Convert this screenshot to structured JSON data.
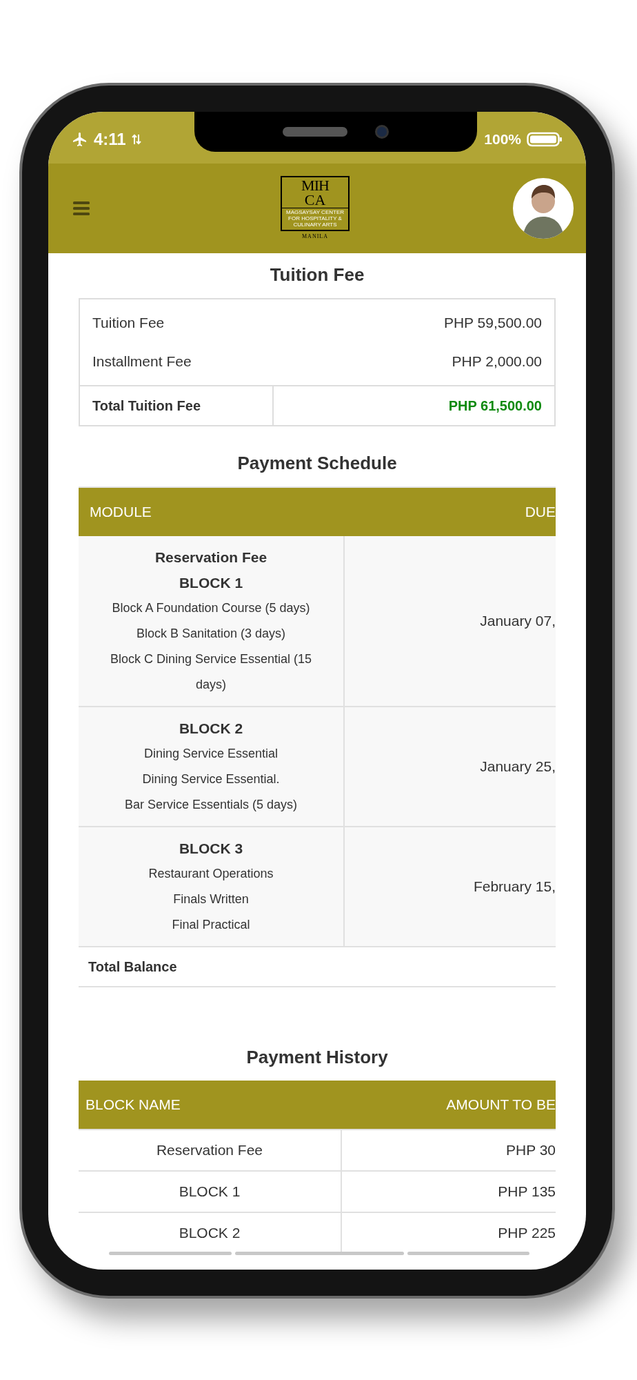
{
  "status_bar": {
    "time": "4:11",
    "battery": "100%",
    "airplane_mode": true
  },
  "header": {
    "logo": {
      "mark_top": "MIH",
      "mark_bottom": "CA",
      "tagline": "MAGSAYSAY CENTER FOR HOSPITALITY & CULINARY ARTS",
      "place": "MANILA"
    }
  },
  "tuition": {
    "title": "Tuition Fee",
    "rows": [
      {
        "label": "Tuition Fee",
        "amount": "PHP 59,500.00"
      },
      {
        "label": "Installment Fee",
        "amount": "PHP 2,000.00"
      }
    ],
    "total": {
      "label": "Total Tuition Fee",
      "amount": "PHP 61,500.00"
    }
  },
  "schedule": {
    "title": "Payment Schedule",
    "columns": [
      "MODULE",
      "DUE"
    ],
    "rows": [
      {
        "headings": [
          "Reservation Fee",
          "BLOCK 1"
        ],
        "items": [
          "Block A Foundation Course (5 days)",
          "Block B Sanitation (3 days)",
          "Block C Dining Service Essential (15 days)"
        ],
        "due": "January 07,"
      },
      {
        "headings": [
          "BLOCK 2"
        ],
        "items": [
          "Dining Service Essential",
          "Dining Service Essential.",
          "Bar Service Essentials (5 days)"
        ],
        "due": "January 25,"
      },
      {
        "headings": [
          "BLOCK 3"
        ],
        "items": [
          "Restaurant Operations",
          "Finals Written",
          "Final Practical"
        ],
        "due": "February 15,"
      }
    ],
    "total_label": "Total Balance"
  },
  "history": {
    "title": "Payment History",
    "columns": [
      "BLOCK NAME",
      "AMOUNT TO BE"
    ],
    "rows": [
      {
        "block": "Reservation Fee",
        "amount": "PHP 30"
      },
      {
        "block": "BLOCK 1",
        "amount": "PHP 135"
      },
      {
        "block": "BLOCK 2",
        "amount": "PHP 225"
      }
    ]
  }
}
